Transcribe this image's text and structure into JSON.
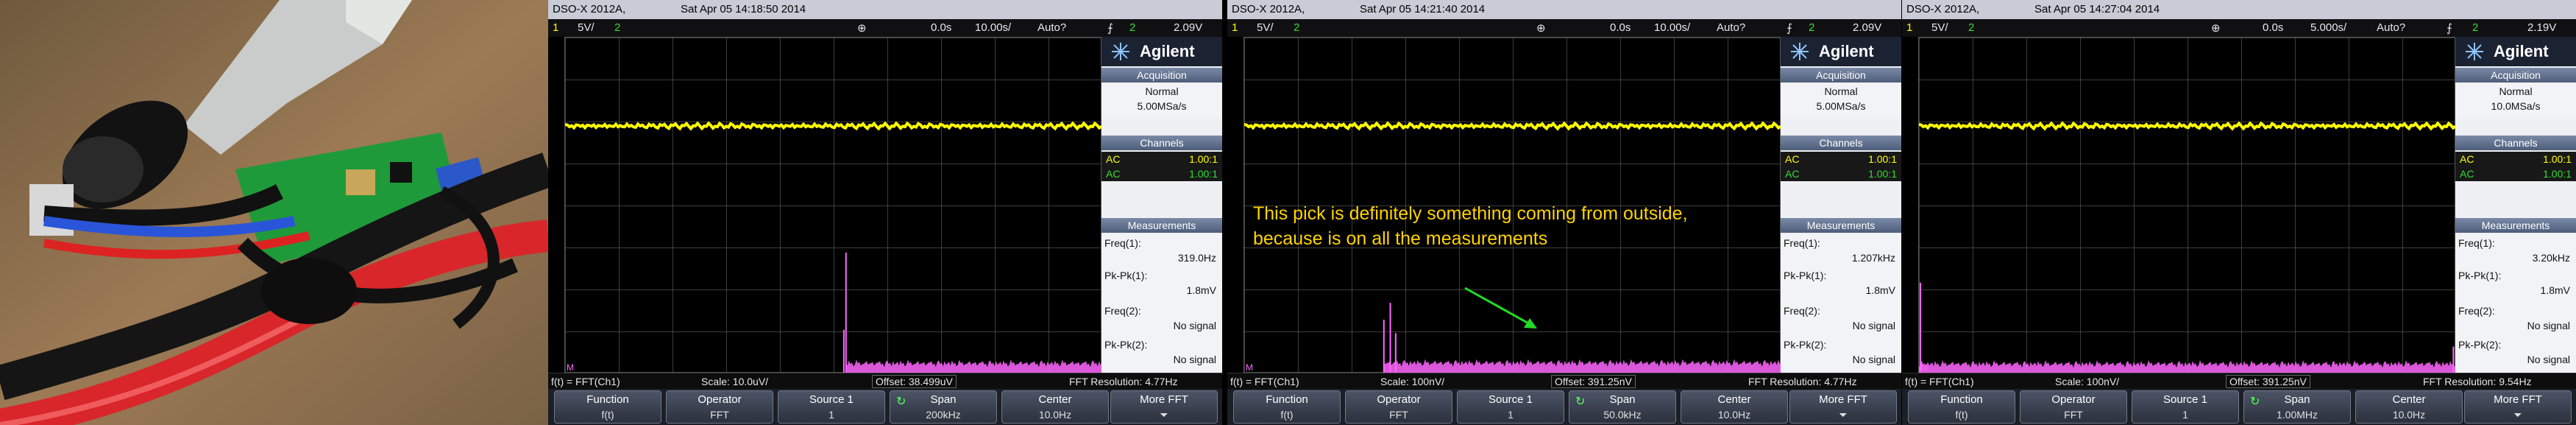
{
  "photo": {
    "description_icon": "circuit-board-photo"
  },
  "screens": [
    {
      "model": "DSO-X 2012A,",
      "datetime": "Sat Apr 05 14:18:50 2014",
      "ch1": "1",
      "ch1_scale": "5V/",
      "ch2": "2",
      "delay": "0.0s",
      "timebase": "10.00s/",
      "trigger_mode": "Auto?",
      "trig_src": "2",
      "trig_level": "2.09V",
      "brand": "Agilent",
      "acq_header": "Acquisition",
      "acq_mode": "Normal",
      "acq_rate": "5.00MSa/s",
      "channels_header": "Channels",
      "channels": [
        {
          "coupling": "AC",
          "probe": "1.00:1"
        },
        {
          "coupling": "AC",
          "probe": "1.00:1"
        }
      ],
      "meas_header": "Measurements",
      "meas": [
        {
          "label": "Freq(1):",
          "value": "319.0Hz"
        },
        {
          "label": "Pk-Pk(1):",
          "value": "1.8mV"
        },
        {
          "label": "Freq(2):",
          "value": "No signal"
        },
        {
          "label": "Pk-Pk(2):",
          "value": "No signal"
        }
      ],
      "fft_src": "f(t) = FFT(Ch1)",
      "fft_scale": "Scale: 10.0uV/",
      "fft_offset": "Offset: 38.499uV",
      "fft_res": "FFT Resolution: 4.77Hz",
      "softkeys": [
        {
          "l1": "Function",
          "l2": "f(t)"
        },
        {
          "l1": "Operator",
          "l2": "FFT"
        },
        {
          "l1": "Source 1",
          "l2": "1"
        },
        {
          "l1": "Span",
          "l2": "200kHz"
        },
        {
          "l1": "Center",
          "l2": "10.0Hz"
        },
        {
          "l1": "More FFT",
          "l2": "⏷"
        }
      ],
      "spikes": [
        {
          "x": 0.523,
          "h": 0.36
        },
        {
          "x": 0.519,
          "h": 0.13
        }
      ]
    },
    {
      "model": "DSO-X 2012A,",
      "datetime": "Sat Apr 05 14:21:40 2014",
      "ch1": "1",
      "ch1_scale": "5V/",
      "ch2": "2",
      "delay": "0.0s",
      "timebase": "10.00s/",
      "trigger_mode": "Auto?",
      "trig_src": "2",
      "trig_level": "2.09V",
      "brand": "Agilent",
      "acq_header": "Acquisition",
      "acq_mode": "Normal",
      "acq_rate": "5.00MSa/s",
      "channels_header": "Channels",
      "channels": [
        {
          "coupling": "AC",
          "probe": "1.00:1"
        },
        {
          "coupling": "AC",
          "probe": "1.00:1"
        }
      ],
      "meas_header": "Measurements",
      "meas": [
        {
          "label": "Freq(1):",
          "value": "1.207kHz"
        },
        {
          "label": "Pk-Pk(1):",
          "value": "1.8mV"
        },
        {
          "label": "Freq(2):",
          "value": "No signal"
        },
        {
          "label": "Pk-Pk(2):",
          "value": "No signal"
        }
      ],
      "fft_src": "f(t) = FFT(Ch1)",
      "fft_scale": "Scale: 100nV/",
      "fft_offset": "Offset: 391.25nV",
      "fft_res": "FFT Resolution: 4.77Hz",
      "softkeys": [
        {
          "l1": "Function",
          "l2": "f(t)"
        },
        {
          "l1": "Operator",
          "l2": "FFT"
        },
        {
          "l1": "Source 1",
          "l2": "1"
        },
        {
          "l1": "Span",
          "l2": "50.0kHz"
        },
        {
          "l1": "Center",
          "l2": "10.0Hz"
        },
        {
          "l1": "More FFT",
          "l2": "⏷"
        }
      ],
      "annotation": [
        "This pick is definitely something coming from outside,",
        "because is on all the measurements"
      ],
      "spikes": [
        {
          "x": 0.26,
          "h": 0.16
        },
        {
          "x": 0.272,
          "h": 0.21
        },
        {
          "x": 0.282,
          "h": 0.12
        }
      ]
    },
    {
      "model": "DSO-X 2012A,",
      "datetime": "Sat Apr 05 14:27:04 2014",
      "ch1": "1",
      "ch1_scale": "5V/",
      "ch2": "2",
      "delay": "0.0s",
      "timebase": "5.000s/",
      "trigger_mode": "Auto?",
      "trig_src": "2",
      "trig_level": "2.19V",
      "brand": "Agilent",
      "acq_header": "Acquisition",
      "acq_mode": "Normal",
      "acq_rate": "10.0MSa/s",
      "channels_header": "Channels",
      "channels": [
        {
          "coupling": "AC",
          "probe": "1.00:1"
        },
        {
          "coupling": "AC",
          "probe": "1.00:1"
        }
      ],
      "meas_header": "Measurements",
      "meas": [
        {
          "label": "Freq(1):",
          "value": "3.20kHz"
        },
        {
          "label": "Pk-Pk(1):",
          "value": "1.8mV"
        },
        {
          "label": "Freq(2):",
          "value": "No signal"
        },
        {
          "label": "Pk-Pk(2):",
          "value": "No signal"
        }
      ],
      "fft_src": "f(t) = FFT(Ch1)",
      "fft_scale": "Scale: 100nV/",
      "fft_offset": "Offset: 391.25nV",
      "fft_res": "FFT Resolution: 9.54Hz",
      "softkeys": [
        {
          "l1": "Function",
          "l2": "f(t)"
        },
        {
          "l1": "Operator",
          "l2": "FFT"
        },
        {
          "l1": "Source 1",
          "l2": "1"
        },
        {
          "l1": "Span",
          "l2": "1.00MHz"
        },
        {
          "l1": "Center",
          "l2": "10.0Hz"
        },
        {
          "l1": "More FFT",
          "l2": "⏷"
        }
      ],
      "spikes": [
        {
          "x": 0.0,
          "h": 0.27
        },
        {
          "x": 0.995,
          "h": 0.08
        }
      ]
    }
  ],
  "colors": {
    "ch1": "#ffff00",
    "ch2": "#33dd33",
    "math": "#ff66ff",
    "annotation": "#ffd400",
    "arrow": "#22dd22"
  }
}
